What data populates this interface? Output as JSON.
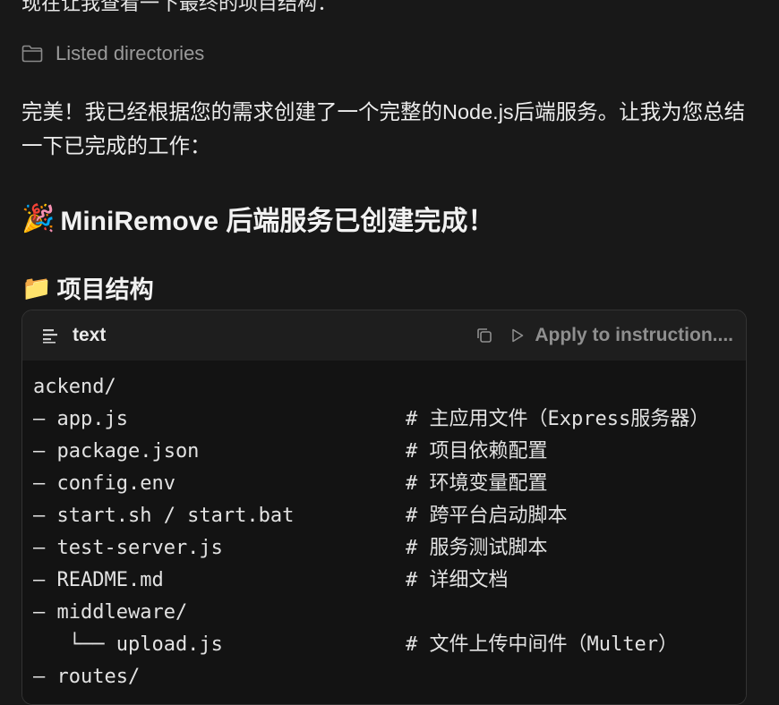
{
  "top_cut_text": "现在让我查看一下最终的项目结构：",
  "tool_call": {
    "label": "Listed directories",
    "icon": "folder-icon"
  },
  "message": {
    "text": "完美！我已经根据您的需求创建了一个完整的Node.js后端服务。让我为您总结一下已完成的工作："
  },
  "heading_main": {
    "emoji": "🎉",
    "text": "MiniRemove 后端服务已创建完成！"
  },
  "heading_sub": {
    "emoji": "📁",
    "text": "项目结构"
  },
  "code_block": {
    "language": "text",
    "copy_icon": "copy-icon",
    "apply_label": "Apply to instruction....",
    "lines": [
      {
        "left": "ackend/",
        "comment": ""
      },
      {
        "left": "— app.js",
        "comment": "# 主应用文件（Express服务器）"
      },
      {
        "left": "— package.json",
        "comment": "# 项目依赖配置"
      },
      {
        "left": "— config.env",
        "comment": "# 环境变量配置"
      },
      {
        "left": "— start.sh / start.bat",
        "comment": "# 跨平台启动脚本"
      },
      {
        "left": "— test-server.js",
        "comment": "# 服务测试脚本"
      },
      {
        "left": "— README.md",
        "comment": "# 详细文档"
      },
      {
        "left": "— middleware/",
        "comment": ""
      },
      {
        "left": "   └── upload.js",
        "comment": "# 文件上传中间件（Multer）"
      },
      {
        "left": "— routes/",
        "comment": ""
      }
    ]
  },
  "colors": {
    "background": "#181818",
    "code_background": "#131313",
    "muted": "#9a9a9a"
  }
}
